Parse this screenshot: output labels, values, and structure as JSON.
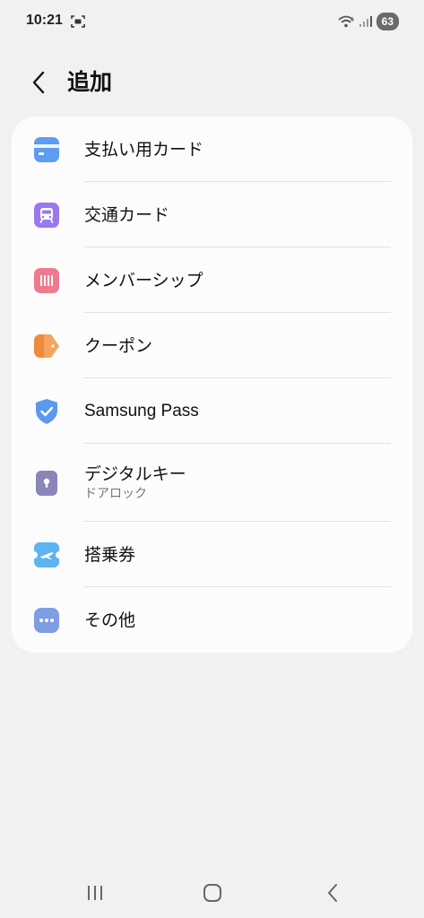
{
  "status_bar": {
    "time": "10:21",
    "battery": "63",
    "icons": [
      "screenshot-icon",
      "wifi-icon",
      "signal-icon",
      "battery-icon"
    ]
  },
  "header": {
    "title": "追加",
    "back_icon": "back-chevron-icon"
  },
  "menu": {
    "items": [
      {
        "label": "支払い用カード",
        "sublabel": "",
        "icon": "payment-card-icon",
        "color": "#5e9bf2"
      },
      {
        "label": "交通カード",
        "sublabel": "",
        "icon": "transit-card-icon",
        "color": "#9a78ee"
      },
      {
        "label": "メンバーシップ",
        "sublabel": "",
        "icon": "membership-icon",
        "color": "#ef7a8d"
      },
      {
        "label": "クーポン",
        "sublabel": "",
        "icon": "coupon-icon",
        "color": "#f5a45d"
      },
      {
        "label": "Samsung Pass",
        "sublabel": "",
        "icon": "samsung-pass-shield-icon",
        "color": "#5b98ee"
      },
      {
        "label": "デジタルキー",
        "sublabel": "ドアロック",
        "icon": "digital-key-icon",
        "color": "#8a86b8"
      },
      {
        "label": "搭乗券",
        "sublabel": "",
        "icon": "boarding-pass-icon",
        "color": "#5db4f0"
      },
      {
        "label": "その他",
        "sublabel": "",
        "icon": "more-icon",
        "color": "#7f9ce6"
      }
    ]
  },
  "navbar": {
    "icons": [
      "recent-apps-icon",
      "home-icon",
      "back-icon"
    ]
  }
}
